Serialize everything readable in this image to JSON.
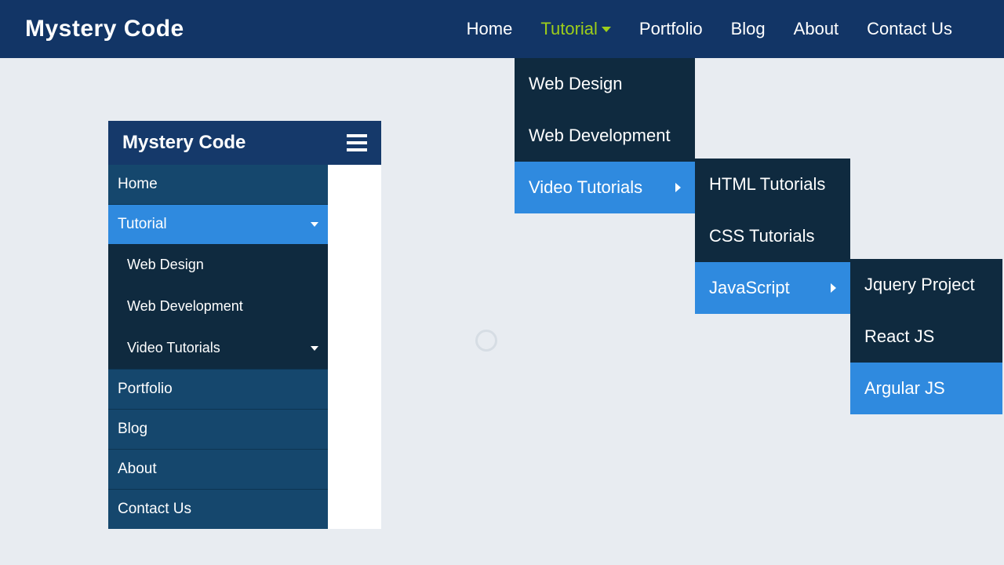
{
  "brand": "Mystery Code",
  "topnav": {
    "home": "Home",
    "tutorial": "Tutorial",
    "portfolio": "Portfolio",
    "blog": "Blog",
    "about": "About",
    "contact": "Contact Us"
  },
  "dropdown1": {
    "web_design": "Web Design",
    "web_development": "Web Development",
    "video_tutorials": "Video Tutorials"
  },
  "dropdown2": {
    "html": "HTML Tutorials",
    "css": "CSS Tutorials",
    "javascript": "JavaScript"
  },
  "dropdown3": {
    "jquery": "Jquery Project",
    "react": "React JS",
    "angular": "Argular JS"
  },
  "panel": {
    "title": "Mystery Code",
    "items": {
      "home": "Home",
      "tutorial": "Tutorial",
      "portfolio": "Portfolio",
      "blog": "Blog",
      "about": "About",
      "contact": "Contact Us"
    },
    "tutorial_sub": {
      "web_design": "Web Design",
      "web_development": "Web Development",
      "video_tutorials": "Video Tutorials"
    }
  }
}
